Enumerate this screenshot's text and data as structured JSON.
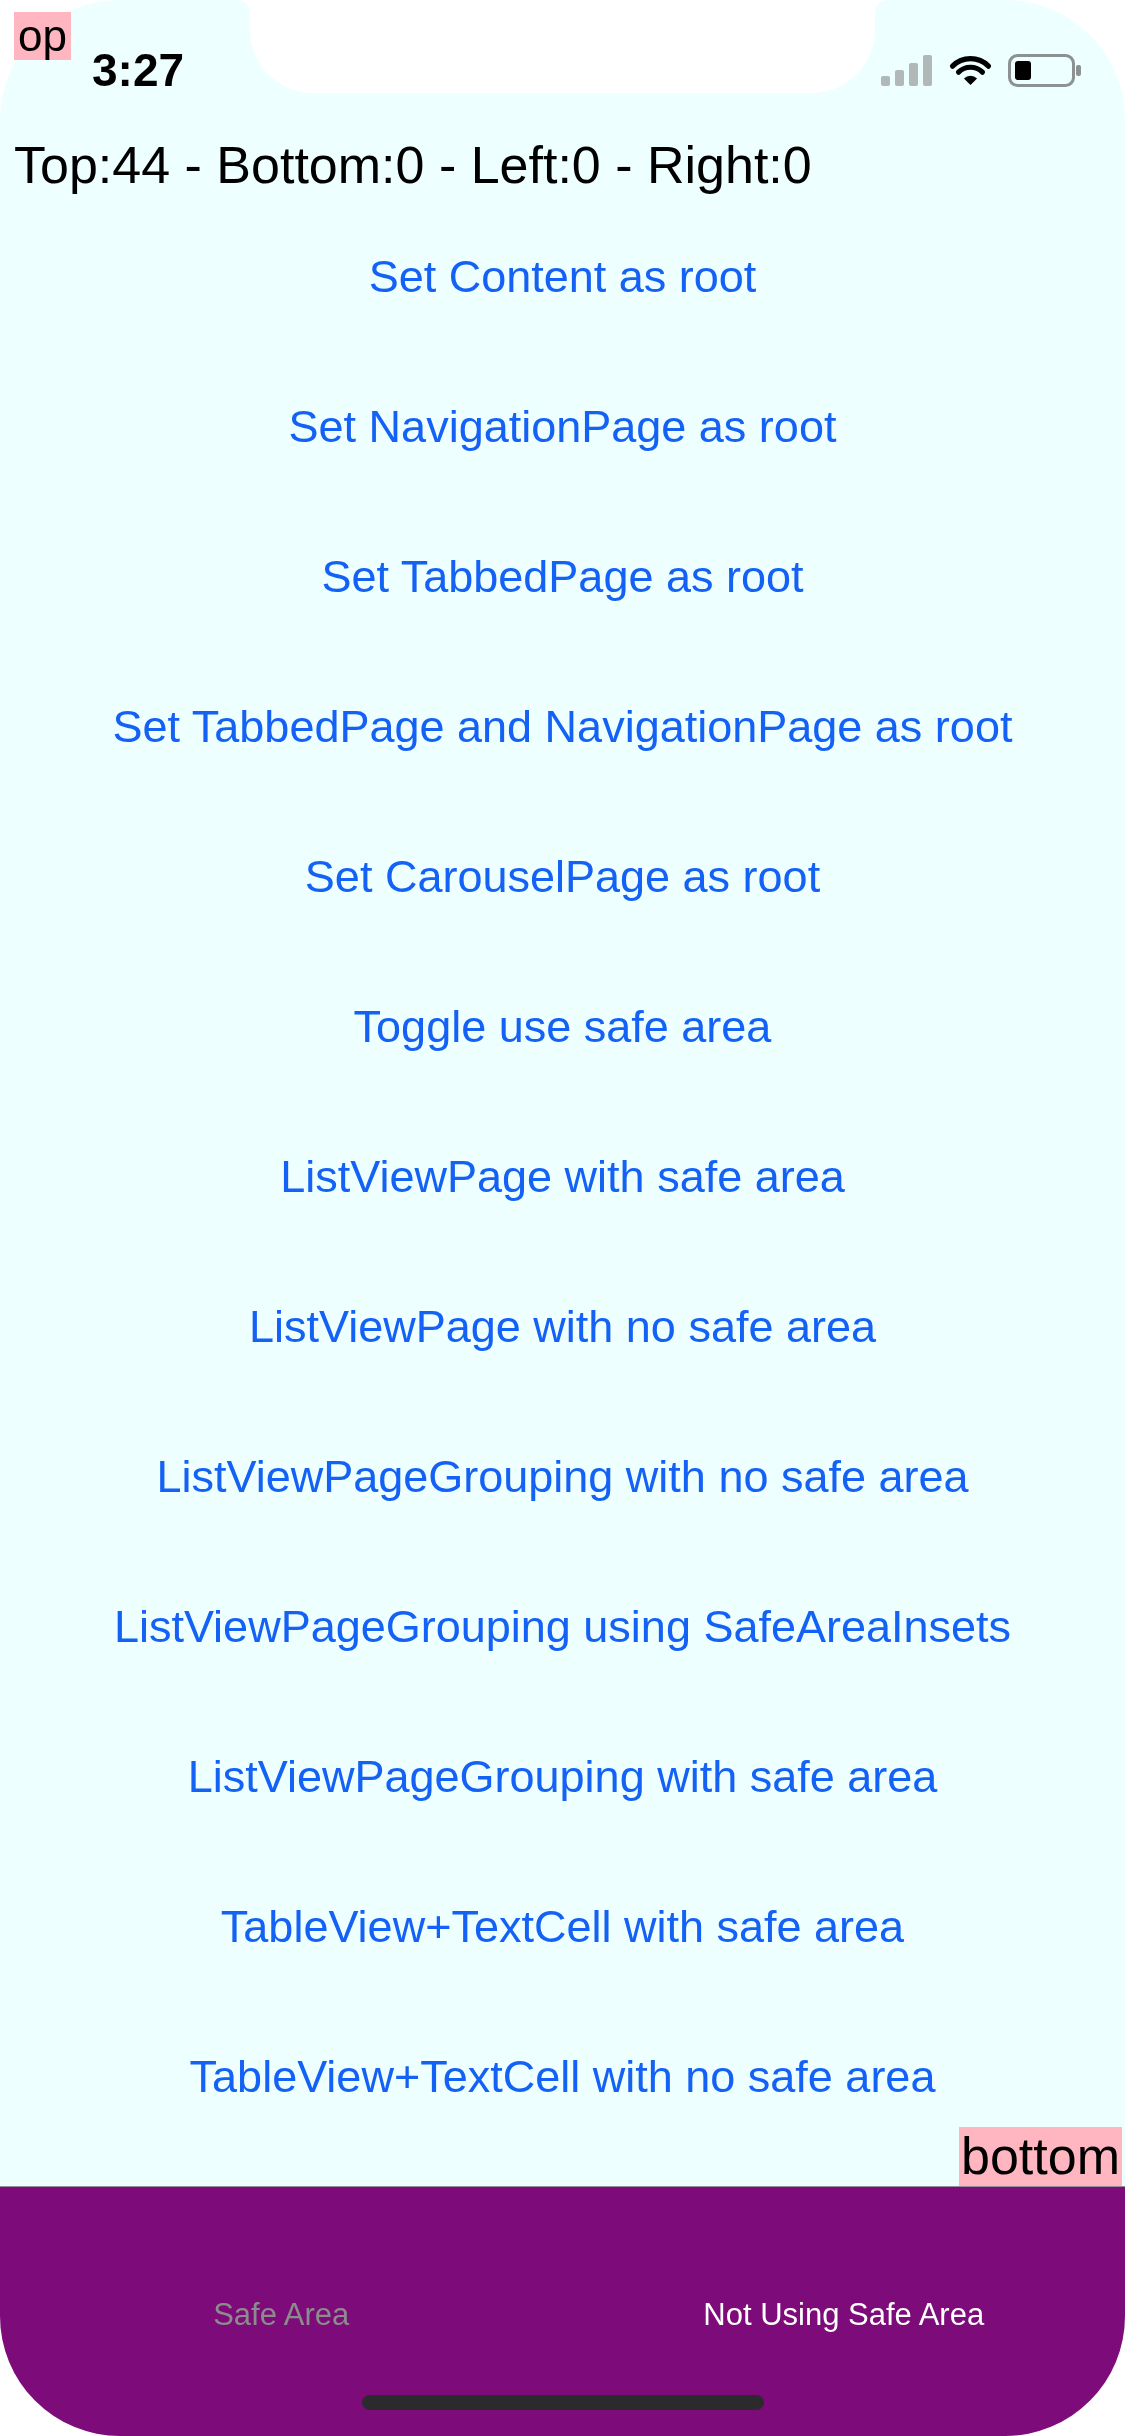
{
  "status_bar": {
    "time": "3:27"
  },
  "top_marker": {
    "label": "op"
  },
  "insets_label": "Top:44 - Bottom:0 - Left:0 - Right:0",
  "buttons": [
    "Set Content as root",
    "Set NavigationPage as root",
    "Set TabbedPage as root",
    "Set TabbedPage and NavigationPage as root",
    "Set CarouselPage as root",
    "Toggle use safe area",
    "ListViewPage with safe area",
    "ListViewPage with no safe area",
    "ListViewPageGrouping with no safe area",
    "ListViewPageGrouping using SafeAreaInsets",
    "ListViewPageGrouping with safe area",
    "TableView+TextCell with safe area",
    "TableView+TextCell with no safe area"
  ],
  "bottom_marker": {
    "label": "bottom"
  },
  "tab_bar": {
    "tabs": [
      {
        "label": "Safe Area",
        "selected": false
      },
      {
        "label": "Not Using Safe Area",
        "selected": true
      }
    ]
  }
}
